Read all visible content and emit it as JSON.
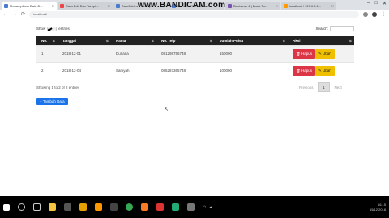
{
  "browser": {
    "tabs": [
      {
        "title": "Menampilkan Data D...",
        "active": true
      },
      {
        "title": "Cara Edit Dan Tampil...",
        "active": false
      },
      {
        "title": "DataTables | Table plu...",
        "active": false
      },
      {
        "title": "Membuat CRUD Mem...",
        "active": false
      },
      {
        "title": "Bootstrap 4 | Basic Ta...",
        "active": false
      },
      {
        "title": "localhost / 127.0.0.1...",
        "active": false
      }
    ],
    "watermark": "www.BANDICAM.com",
    "url": "localhost/...",
    "win_minimize": "–",
    "win_maximize": "□",
    "win_close": "✕",
    "nav_back": "←",
    "nav_forward": "→",
    "nav_reload": "⟳"
  },
  "table_controls": {
    "show_label": "Show",
    "show_value": "10",
    "entries_label": "entries",
    "search_label": "Search:"
  },
  "table": {
    "headers": [
      "No.",
      "Tanggal",
      "Nama",
      "No. Telp",
      "Jumlah Pulsa",
      "Aksi"
    ],
    "rows": [
      {
        "no": "1",
        "tanggal": "2018-12-01",
        "nama": "Durjana",
        "telp": "081298756748",
        "pulsa": "150000"
      },
      {
        "no": "2",
        "tanggal": "2018-12-04",
        "nama": "Sartiyah",
        "telp": "085287365748",
        "pulsa": "100000"
      }
    ],
    "delete_label": "Hapus",
    "edit_label": "Ubah"
  },
  "footer": {
    "info": "Showing 1 to 2 of 2 entries",
    "prev": "Previous",
    "page": "1",
    "next": "Next",
    "add_button": "Tambah Data"
  },
  "taskbar": {
    "time": "16.15",
    "date": "15/12/2018"
  }
}
